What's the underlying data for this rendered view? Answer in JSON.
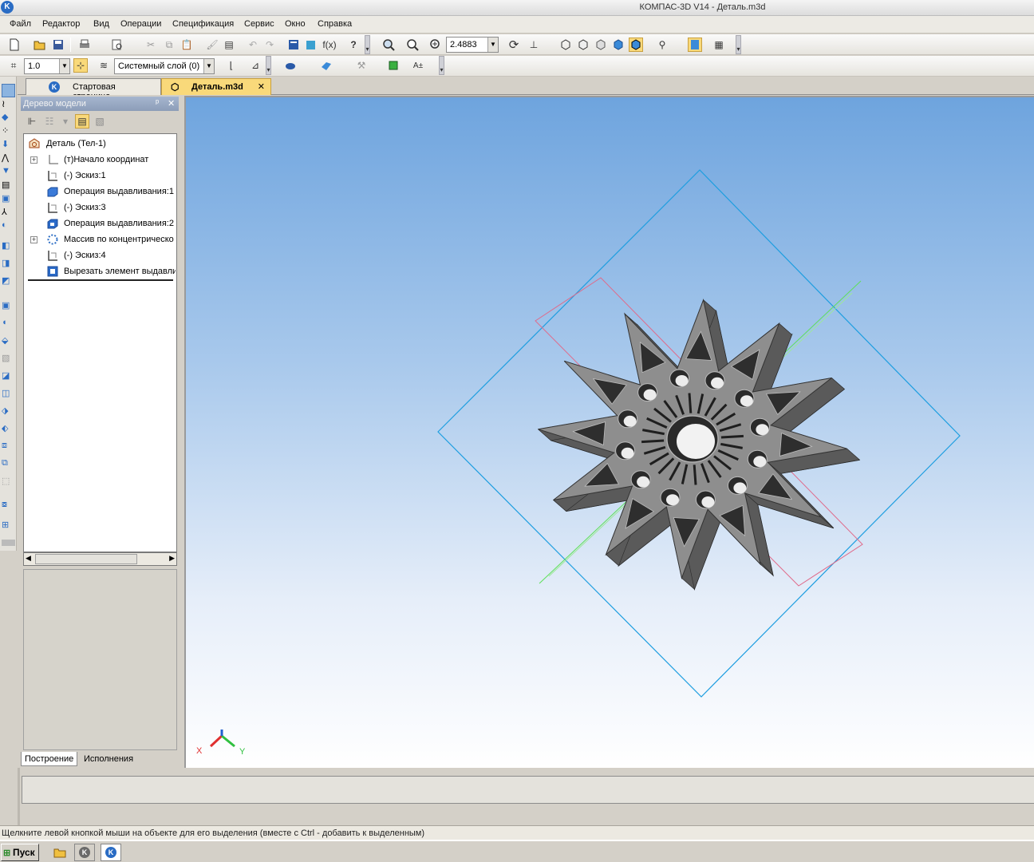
{
  "window": {
    "title": "КОМПАС-3D V14 - Деталь.m3d",
    "logo": "K"
  },
  "menu": [
    "Файл",
    "Редактор",
    "Вид",
    "Операции",
    "Спецификация",
    "Сервис",
    "Окно",
    "Справка"
  ],
  "toolbar": {
    "zoom_value": "2.4883",
    "step_value": "1.0",
    "layer_value": "Системный слой (0)"
  },
  "tabs": [
    {
      "label": "Стартовая страница",
      "active": false
    },
    {
      "label": "Деталь.m3d",
      "active": true,
      "close": "✕"
    }
  ],
  "tree": {
    "title": "Дерево модели",
    "pin": "ᵖ",
    "close": "✕",
    "items": [
      {
        "label": "Деталь (Тел-1)",
        "icon": "part-icon",
        "indent": 0
      },
      {
        "label": "(т)Начало координат",
        "icon": "origin-icon",
        "indent": 1,
        "expandable": true
      },
      {
        "label": "(-) Эскиз:1",
        "icon": "sketch-icon",
        "indent": 1
      },
      {
        "label": "Операция выдавливания:1",
        "icon": "extrude-icon",
        "indent": 1
      },
      {
        "label": "(-) Эскиз:3",
        "icon": "sketch-icon",
        "indent": 1
      },
      {
        "label": "Операция выдавливания:2",
        "icon": "extrude-icon",
        "indent": 1
      },
      {
        "label": "Массив по концентрическо",
        "icon": "array-icon",
        "indent": 1,
        "expandable": true
      },
      {
        "label": "(-) Эскиз:4",
        "icon": "sketch-icon",
        "indent": 1
      },
      {
        "label": "Вырезать элемент выдавли",
        "icon": "cut-icon",
        "indent": 1
      }
    ],
    "bottom_tabs": [
      "Построение",
      "Исполнения"
    ]
  },
  "axes": {
    "x": "X",
    "y": "Y"
  },
  "status": {
    "hint": "Щелкните левой кнопкой мыши на объекте для его выделения (вместе с Ctrl - добавить к выделенным)"
  },
  "taskbar": {
    "start": "Пуск"
  },
  "colors": {
    "accent": "#2a6cc4",
    "viewport_top": "#6ea4de",
    "model": "#8e8e8e",
    "selection": "#f9d97a"
  }
}
